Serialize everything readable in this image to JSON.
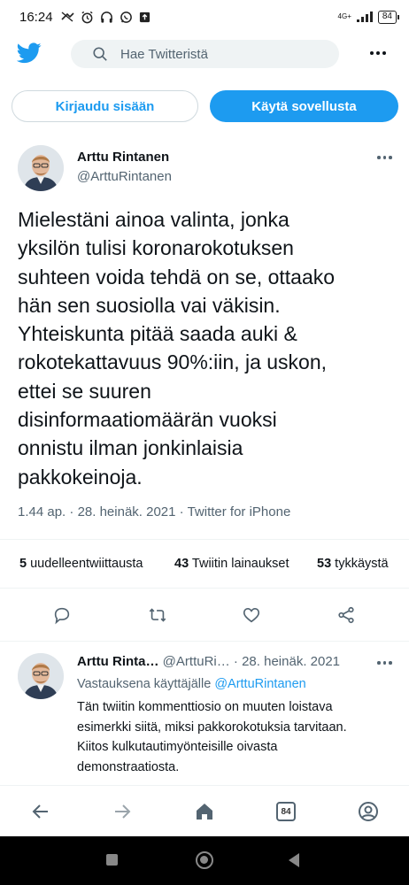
{
  "status_bar": {
    "time": "16:24",
    "network": "4G+",
    "battery": "84"
  },
  "top_bar": {
    "search_placeholder": "Hae Twitteristä"
  },
  "auth": {
    "login_label": "Kirjaudu sisään",
    "app_label": "Käytä sovellusta"
  },
  "tweet": {
    "author_name": "Arttu Rintanen",
    "author_handle": "@ArttuRintanen",
    "text": "Mielestäni ainoa valinta, jonka\nyksilön tulisi koronarokotuksen\nsuhteen voida tehdä on se, ottaako\nhän sen suosiolla vai väkisin.\nYhteiskunta pitää saada auki &\nrokotekattavuus 90%:iin, ja uskon,\nettei se suuren\ndisinformaatiomäärän vuoksi\nonnistu ilman jonkinlaisia\npakkokeinoja.",
    "time": "1.44 ap.",
    "date": "28. heinäk. 2021",
    "source": "Twitter for iPhone",
    "sep": "·",
    "retweets_count": "5",
    "retweets_label": "uudelleentwiittausta",
    "quotes_count": "43",
    "quotes_label": "Twiitin lainaukset",
    "likes_count": "53",
    "likes_label": "tykkäystä"
  },
  "reply": {
    "author_name": "Arttu Rinta…",
    "author_handle": "@ArttuRi…",
    "sep": "·",
    "date": "28. heinäk. 2021",
    "replying_to_label": "Vastauksena käyttäjälle",
    "replying_to_handle": "@ArttuRintanen",
    "text": "Tän twiitin kommenttiosio on muuten loistava esimerkki siitä, miksi pakkorokotuksia tarvitaan. Kiitos kulkutautimyönteisille oivasta demonstraatiosta."
  },
  "browser_nav": {
    "tab_count": "84"
  },
  "colors": {
    "accent": "#1d9bf0",
    "secondary_text": "#536471"
  }
}
